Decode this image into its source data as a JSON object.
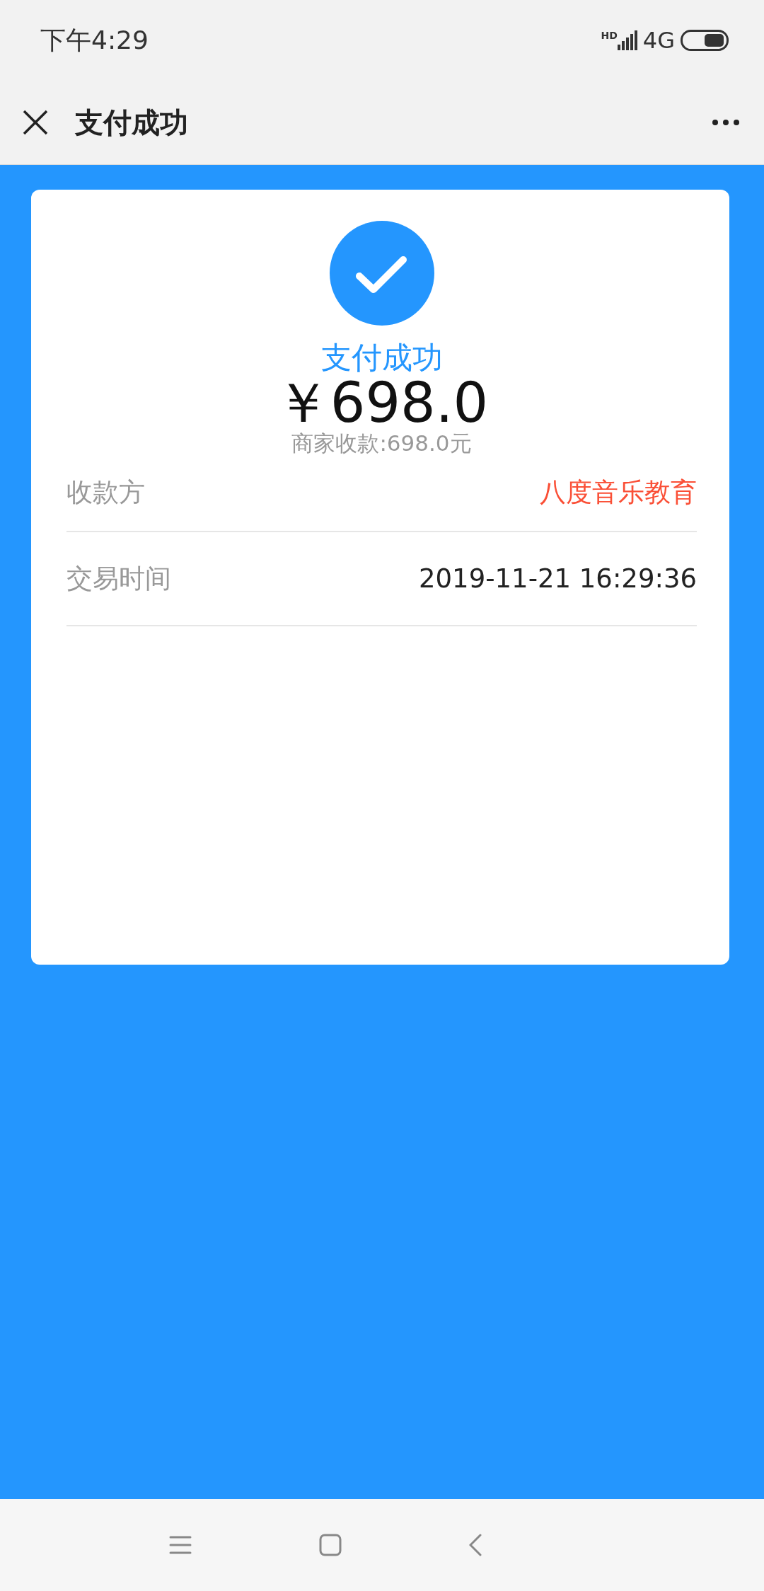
{
  "status_bar": {
    "time": "下午4:29",
    "signal_label": "HD",
    "network": "4G"
  },
  "header": {
    "title": "支付成功"
  },
  "result": {
    "status": "支付成功",
    "amount": "￥698.0",
    "merchant_note": "商家收款:698.0元"
  },
  "details": [
    {
      "label": "收款方",
      "value": "八度音乐教育",
      "kind": "highlight"
    },
    {
      "label": "交易时间",
      "value": "2019-11-21 16:29:36",
      "kind": "plain"
    }
  ]
}
